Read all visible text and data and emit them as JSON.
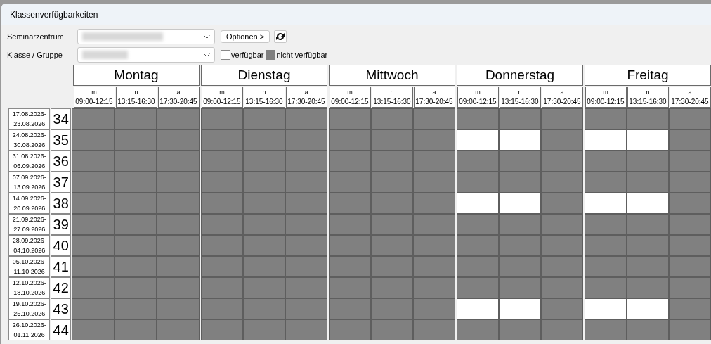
{
  "window": {
    "title": "Klassenverfügbarkeiten"
  },
  "filters": [
    {
      "label": "Seminarzentrum"
    },
    {
      "label": "Klasse / Gruppe"
    }
  ],
  "options_button": "Optionen >",
  "legend": [
    {
      "label": "verfügbar",
      "available": true
    },
    {
      "label": "nicht verfügbar",
      "available": false
    }
  ],
  "days": [
    {
      "name": "Montag",
      "slots": [
        {
          "code": "m",
          "time": "09:00-12:15"
        },
        {
          "code": "n",
          "time": "13:15-16:30"
        },
        {
          "code": "a",
          "time": "17:30-20:45"
        }
      ]
    },
    {
      "name": "Dienstag",
      "slots": [
        {
          "code": "m",
          "time": "09:00-12:15"
        },
        {
          "code": "n",
          "time": "13:15-16:30"
        },
        {
          "code": "a",
          "time": "17:30-20:45"
        }
      ]
    },
    {
      "name": "Mittwoch",
      "slots": [
        {
          "code": "m",
          "time": "09:00-12:15"
        },
        {
          "code": "n",
          "time": "13:15-16:30"
        },
        {
          "code": "a",
          "time": "17:30-20:45"
        }
      ]
    },
    {
      "name": "Donnerstag",
      "slots": [
        {
          "code": "m",
          "time": "09:00-12:15"
        },
        {
          "code": "n",
          "time": "13:15-16:30"
        },
        {
          "code": "a",
          "time": "17:30-20:45"
        }
      ]
    },
    {
      "name": "Freitag",
      "slots": [
        {
          "code": "m",
          "time": "09:00-12:15"
        },
        {
          "code": "n",
          "time": "13:15-16:30"
        },
        {
          "code": "a",
          "time": "17:30-20:45"
        }
      ]
    }
  ],
  "weeks": [
    {
      "from": "17.08.2026-",
      "to": "23.08.2026",
      "week": "34",
      "available": [
        false,
        false,
        false,
        false,
        false,
        false,
        false,
        false,
        false,
        false,
        false,
        false,
        false,
        false,
        false
      ]
    },
    {
      "from": "24.08.2026-",
      "to": "30.08.2026",
      "week": "35",
      "available": [
        false,
        false,
        false,
        false,
        false,
        false,
        false,
        false,
        false,
        true,
        true,
        false,
        true,
        true,
        false
      ]
    },
    {
      "from": "31.08.2026-",
      "to": "06.09.2026",
      "week": "36",
      "available": [
        false,
        false,
        false,
        false,
        false,
        false,
        false,
        false,
        false,
        false,
        false,
        false,
        false,
        false,
        false
      ]
    },
    {
      "from": "07.09.2026-",
      "to": "13.09.2026",
      "week": "37",
      "available": [
        false,
        false,
        false,
        false,
        false,
        false,
        false,
        false,
        false,
        false,
        false,
        false,
        false,
        false,
        false
      ]
    },
    {
      "from": "14.09.2026-",
      "to": "20.09.2026",
      "week": "38",
      "available": [
        false,
        false,
        false,
        false,
        false,
        false,
        false,
        false,
        false,
        true,
        true,
        false,
        true,
        true,
        false
      ]
    },
    {
      "from": "21.09.2026-",
      "to": "27.09.2026",
      "week": "39",
      "available": [
        false,
        false,
        false,
        false,
        false,
        false,
        false,
        false,
        false,
        false,
        false,
        false,
        false,
        false,
        false
      ]
    },
    {
      "from": "28.09.2026-",
      "to": "04.10.2026",
      "week": "40",
      "available": [
        false,
        false,
        false,
        false,
        false,
        false,
        false,
        false,
        false,
        false,
        false,
        false,
        false,
        false,
        false
      ]
    },
    {
      "from": "05.10.2026-",
      "to": "11.10.2026",
      "week": "41",
      "available": [
        false,
        false,
        false,
        false,
        false,
        false,
        false,
        false,
        false,
        false,
        false,
        false,
        false,
        false,
        false
      ]
    },
    {
      "from": "12.10.2026-",
      "to": "18.10.2026",
      "week": "42",
      "available": [
        false,
        false,
        false,
        false,
        false,
        false,
        false,
        false,
        false,
        false,
        false,
        false,
        false,
        false,
        false
      ]
    },
    {
      "from": "19.10.2026-",
      "to": "25.10.2026",
      "week": "43",
      "available": [
        false,
        false,
        false,
        false,
        false,
        false,
        false,
        false,
        false,
        true,
        true,
        false,
        true,
        true,
        false
      ]
    },
    {
      "from": "26.10.2026-",
      "to": "01.11.2026",
      "week": "44",
      "available": [
        false,
        false,
        false,
        false,
        false,
        false,
        false,
        false,
        false,
        false,
        false,
        false,
        false,
        false,
        false
      ]
    }
  ]
}
